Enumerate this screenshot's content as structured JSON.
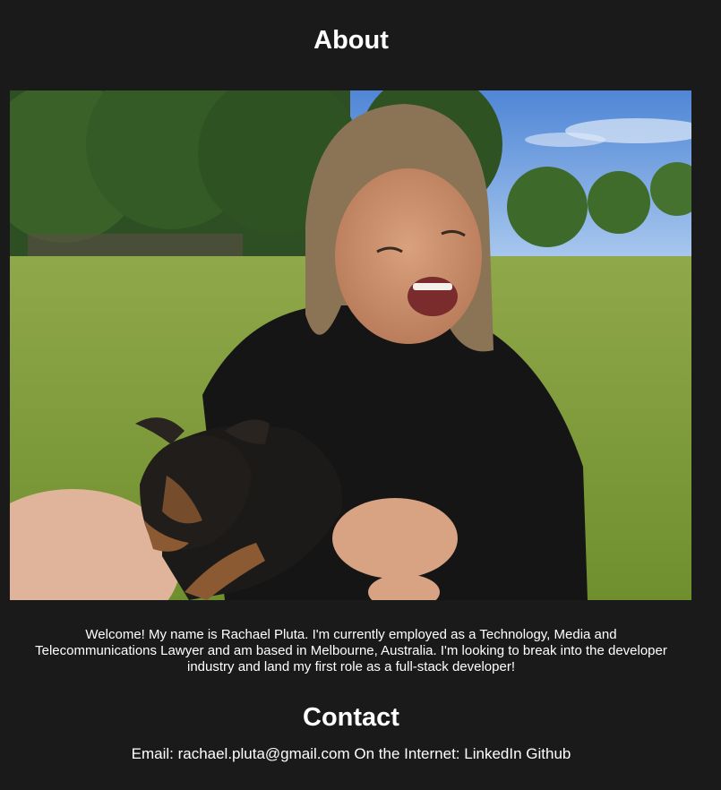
{
  "about": {
    "title": "About",
    "bio": "Welcome! My name is Rachael Pluta. I'm currently employed as a Technology, Media and Telecommunications Lawyer and am based in Melbourne, Australia. I'm looking to break into the developer industry and land my first role as a full-stack developer!"
  },
  "contact": {
    "title": "Contact",
    "email_label": "Email:",
    "email": "rachael.pluta@gmail.com",
    "internet_label": "On the Internet:",
    "linkedin": "LinkedIn",
    "github": "Github"
  },
  "colors": {
    "background": "#1a1a1a",
    "text": "#ffffff"
  }
}
